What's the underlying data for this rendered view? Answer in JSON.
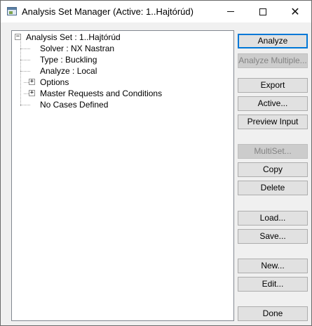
{
  "window": {
    "title": "Analysis Set Manager (Active: 1..Hajtórúd)",
    "minimize_glyph": "",
    "close_glyph": "✕"
  },
  "tree": {
    "root": {
      "expander": "−",
      "label": "Analysis Set : 1..Hajtórúd"
    },
    "children": [
      {
        "label": "Solver : NX Nastran"
      },
      {
        "label": "Type : Buckling"
      },
      {
        "label": "Analyze : Local"
      },
      {
        "expander": "+",
        "label": "Options"
      },
      {
        "expander": "+",
        "label": "Master Requests and Conditions"
      },
      {
        "label": "No Cases Defined"
      }
    ]
  },
  "buttons": {
    "analyze": "Analyze",
    "analyze_multiple": "Analyze Multiple...",
    "export": "Export",
    "active": "Active...",
    "preview_input": "Preview Input",
    "multiset": "MultiSet...",
    "copy": "Copy",
    "delete": "Delete",
    "load": "Load...",
    "save": "Save...",
    "new": "New...",
    "edit": "Edit...",
    "done": "Done"
  },
  "icons": {
    "app": "analysis-set-manager-icon",
    "minimize": "minimize-icon",
    "maximize": "maximize-icon",
    "close": "close-icon"
  },
  "colors": {
    "window_bg": "#f0f0f0",
    "default_button_border": "#0078d7",
    "disabled_text": "#838383"
  }
}
